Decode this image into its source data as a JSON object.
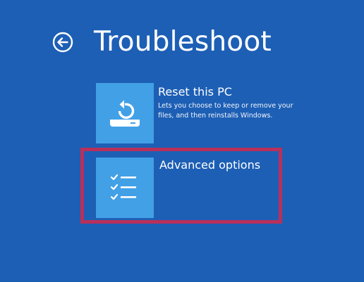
{
  "page": {
    "title": "Troubleshoot"
  },
  "options": [
    {
      "title": "Reset this PC",
      "description": "Lets you choose to keep or remove your files, and then reinstalls Windows.",
      "icon": "reset-pc-icon"
    },
    {
      "title": "Advanced options",
      "description": "",
      "icon": "checklist-icon",
      "selected": true
    }
  ],
  "colors": {
    "background": "#1d5fb5",
    "tile": "#42a0e6",
    "highlight": "#b8305a",
    "text": "#ffffff"
  }
}
